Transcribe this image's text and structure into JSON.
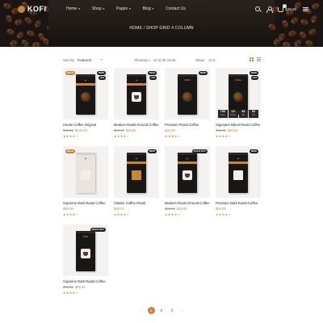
{
  "brand": {
    "name": "KOFI",
    "accent": "#c9853a"
  },
  "nav": {
    "items": [
      {
        "label": "Home",
        "has_menu": true
      },
      {
        "label": "Shop",
        "has_menu": true
      },
      {
        "label": "Pages",
        "has_menu": true
      },
      {
        "label": "Blog",
        "has_menu": true
      },
      {
        "label": "Contact Us",
        "has_menu": false
      }
    ],
    "cart_count": "0",
    "cart_total": "$29.00"
  },
  "breadcrumb": "HOME  /  SHOP GRID 4 COLUMN",
  "toolbar": {
    "sort_label": "Sort by:",
    "sort_value": "Featured",
    "showing": "Showing 1 - 12 of 25 result",
    "show_label": "Show:",
    "show_value": "12"
  },
  "products": [
    {
      "name": "House Coffee Original",
      "old_price": "$28.00",
      "price": "$120.00",
      "rating": 4,
      "badges": [
        "SALE",
        "NEW",
        "-8%"
      ]
    },
    {
      "name": "Medium Roast Ground Coffee",
      "old_price": "$20.00",
      "price": "$19.00",
      "rating": 4,
      "badges": [
        "NEW",
        "-5%"
      ]
    },
    {
      "name": "Premium Roast Coffee",
      "old_price": "",
      "price": "$31.00",
      "rating": 4,
      "badges": [
        "NEW"
      ]
    },
    {
      "name": "Signature Blend Roast Coffee",
      "old_price": "$19.00",
      "price": "$30.00",
      "rating": 4,
      "badges": [
        "NEW",
        "-6%"
      ],
      "countdown": [
        {
          "num": "706",
          "lbl": "Days"
        },
        {
          "num": "13",
          "lbl": "Hours"
        },
        {
          "num": "45",
          "lbl": "Min"
        },
        {
          "num": "52",
          "lbl": "Sec"
        }
      ]
    },
    {
      "name": "Supreme Dark Roast Coffee",
      "old_price": "",
      "price": "$60.00",
      "rating": 4,
      "badges": [
        "SALE"
      ]
    },
    {
      "name": "Classic Coffee Roast",
      "old_price": "",
      "price": "$39.00",
      "rating": 4,
      "badges": [
        "NEW"
      ]
    },
    {
      "name": "Medium Roast Ground Coffee",
      "old_price": "$25.00",
      "price": "$19.00",
      "rating": 4,
      "badges": [
        "SOLD OUT"
      ]
    },
    {
      "name": "Premium Dark Roast Coffee",
      "old_price": "",
      "price": "$50.00",
      "rating": 4,
      "badges": [
        "NEW"
      ]
    },
    {
      "name": "Supreme Dark Roast Coffee",
      "old_price": "$70.00",
      "price": "$65.00",
      "rating": 4,
      "badges": [
        "SOLD OUT"
      ]
    }
  ],
  "pagination": {
    "prev": "‹",
    "pages": [
      "1",
      "2",
      "3"
    ],
    "next": "›",
    "current": "1"
  }
}
